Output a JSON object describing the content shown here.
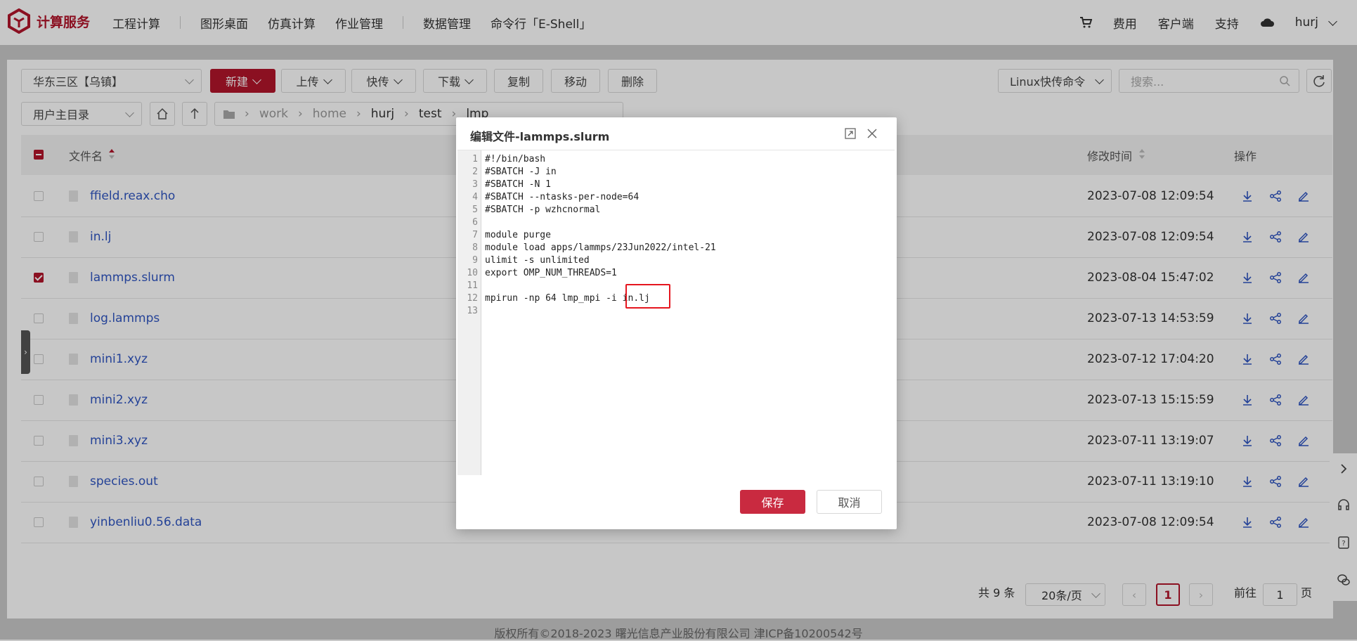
{
  "brand": {
    "name": "计算服务",
    "color": "#b3152b"
  },
  "nav": {
    "items": [
      "工程计算",
      "图形桌面",
      "仿真计算",
      "作业管理",
      "数据管理",
      "命令行「E-Shell」"
    ],
    "right": {
      "cart_icon": "cart-icon",
      "fees": "费用",
      "client": "客户端",
      "support": "支持",
      "cloud_icon": "cloud-icon",
      "user": "hurj"
    }
  },
  "toolbar": {
    "region": "华东三区【乌镇】",
    "new": "新建",
    "upload": "上传",
    "fast_transfer": "快传",
    "download": "下载",
    "copy": "复制",
    "move": "移动",
    "delete": "删除",
    "linux_cmd": "Linux快传命令",
    "search_placeholder": "搜索...",
    "home_dir": "用户主目录"
  },
  "breadcrumb": [
    "work",
    "home",
    "hurj",
    "test",
    "lmp"
  ],
  "table": {
    "col_name": "文件名",
    "col_mtime": "修改时间",
    "col_actions": "操作",
    "rows": [
      {
        "name": "ffield.reax.cho",
        "mtime": "2023-07-08 12:09:54",
        "checked": false
      },
      {
        "name": "in.lj",
        "mtime": "2023-07-08 12:09:54",
        "checked": false
      },
      {
        "name": "lammps.slurm",
        "mtime": "2023-08-04 15:47:02",
        "checked": true
      },
      {
        "name": "log.lammps",
        "mtime": "2023-07-13 14:53:59",
        "checked": false
      },
      {
        "name": "mini1.xyz",
        "mtime": "2023-07-12 17:04:20",
        "checked": false
      },
      {
        "name": "mini2.xyz",
        "mtime": "2023-07-13 15:15:59",
        "checked": false
      },
      {
        "name": "mini3.xyz",
        "mtime": "2023-07-11 13:19:07",
        "checked": false
      },
      {
        "name": "species.out",
        "mtime": "2023-07-11 13:19:10",
        "checked": false
      },
      {
        "name": "yinbenliu0.56.data",
        "mtime": "2023-07-08 12:09:54",
        "checked": false
      }
    ]
  },
  "pager": {
    "total": "共 9 条",
    "page_size": "20条/页",
    "current": "1",
    "goto_label": "前往",
    "goto_value": "1",
    "page_suffix": "页"
  },
  "footer": "版权所有©2018-2023 曙光信息产业股份有限公司 津ICP备10200542号",
  "modal": {
    "title": "编辑文件-lammps.slurm",
    "lines": [
      "#!/bin/bash",
      "#SBATCH -J in",
      "#SBATCH -N 1",
      "#SBATCH --ntasks-per-node=64",
      "#SBATCH -p wzhcnormal",
      "",
      "module purge",
      "module load apps/lammps/23Jun2022/intel-21",
      "ulimit -s unlimited",
      "export OMP_NUM_THREADS=1",
      "",
      "mpirun -np 64 lmp_mpi -i in.lj",
      ""
    ],
    "line_numbers": [
      "1",
      "2",
      "3",
      "4",
      "5",
      "6",
      "7",
      "8",
      "9",
      "10",
      "11",
      "12",
      "13"
    ],
    "save": "保存",
    "cancel": "取消"
  }
}
